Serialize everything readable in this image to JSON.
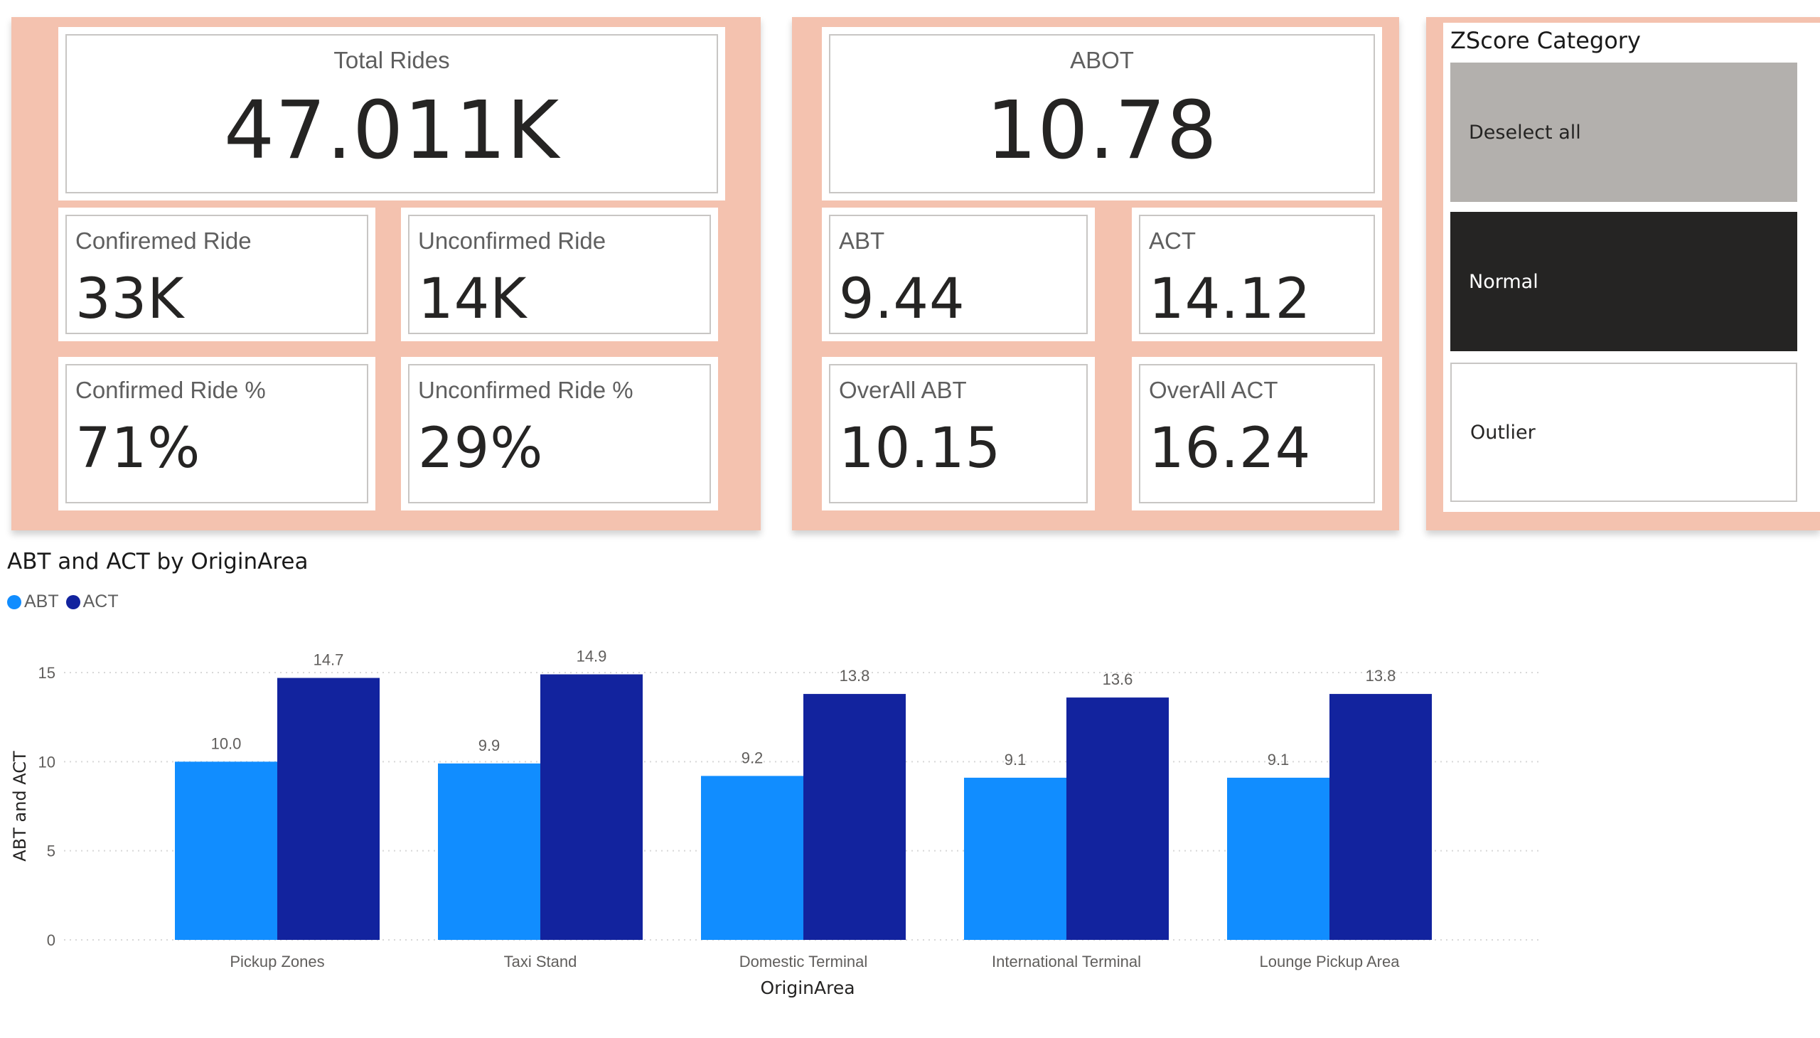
{
  "rides_card": {
    "total": {
      "label": "Total Rides",
      "value": "47.011K"
    },
    "confirmed": {
      "label": "Confiremed Ride",
      "value": "33K"
    },
    "unconfirmed": {
      "label": "Unconfirmed Ride",
      "value": "14K"
    },
    "confirmed_pct": {
      "label": "Confirmed Ride %",
      "value": "71%"
    },
    "unconfirmed_pct": {
      "label": "Unconfirmed Ride %",
      "value": "29%"
    }
  },
  "times_card": {
    "abot": {
      "label": "ABOT",
      "value": "10.78"
    },
    "abt": {
      "label": "ABT",
      "value": "9.44"
    },
    "act": {
      "label": "ACT",
      "value": "14.12"
    },
    "overall_abt": {
      "label": "OverAll ABT",
      "value": "10.15"
    },
    "overall_act": {
      "label": "OverAll ACT",
      "value": "16.24"
    }
  },
  "slicer": {
    "title": "ZScore Category",
    "options": [
      {
        "label": "Deselect all",
        "state": "hover"
      },
      {
        "label": "Normal",
        "state": "selected"
      },
      {
        "label": "Outlier",
        "state": "unselected"
      }
    ]
  },
  "colors": {
    "panel_background": "#f4c2af",
    "abt_series": "#118dff",
    "act_series": "#12239e",
    "slicer_selected": "#252423",
    "slicer_hover": "#b3b0ad"
  },
  "chart": {
    "title": "ABT and ACT by OriginArea"
  },
  "chart_data": {
    "type": "bar",
    "title": "ABT and ACT by OriginArea",
    "xlabel": "OriginArea",
    "ylabel": "ABT and ACT",
    "categories": [
      "Pickup Zones",
      "Taxi Stand",
      "Domestic Terminal",
      "International Terminal",
      "Lounge Pickup Area"
    ],
    "series": [
      {
        "name": "ABT",
        "values": [
          10.0,
          9.9,
          9.2,
          9.1,
          9.1
        ],
        "labels": [
          "10.0",
          "9.9",
          "9.2",
          "9.1",
          "9.1"
        ],
        "color": "#118dff"
      },
      {
        "name": "ACT",
        "values": [
          14.7,
          14.9,
          13.8,
          13.6,
          13.8
        ],
        "labels": [
          "14.7",
          "14.9",
          "13.8",
          "13.6",
          "13.8"
        ],
        "color": "#12239e"
      }
    ],
    "ylim": [
      0,
      15
    ],
    "yticks": [
      0,
      5,
      10,
      15
    ],
    "grid": true,
    "legend": "top-left",
    "data_labels": true
  }
}
